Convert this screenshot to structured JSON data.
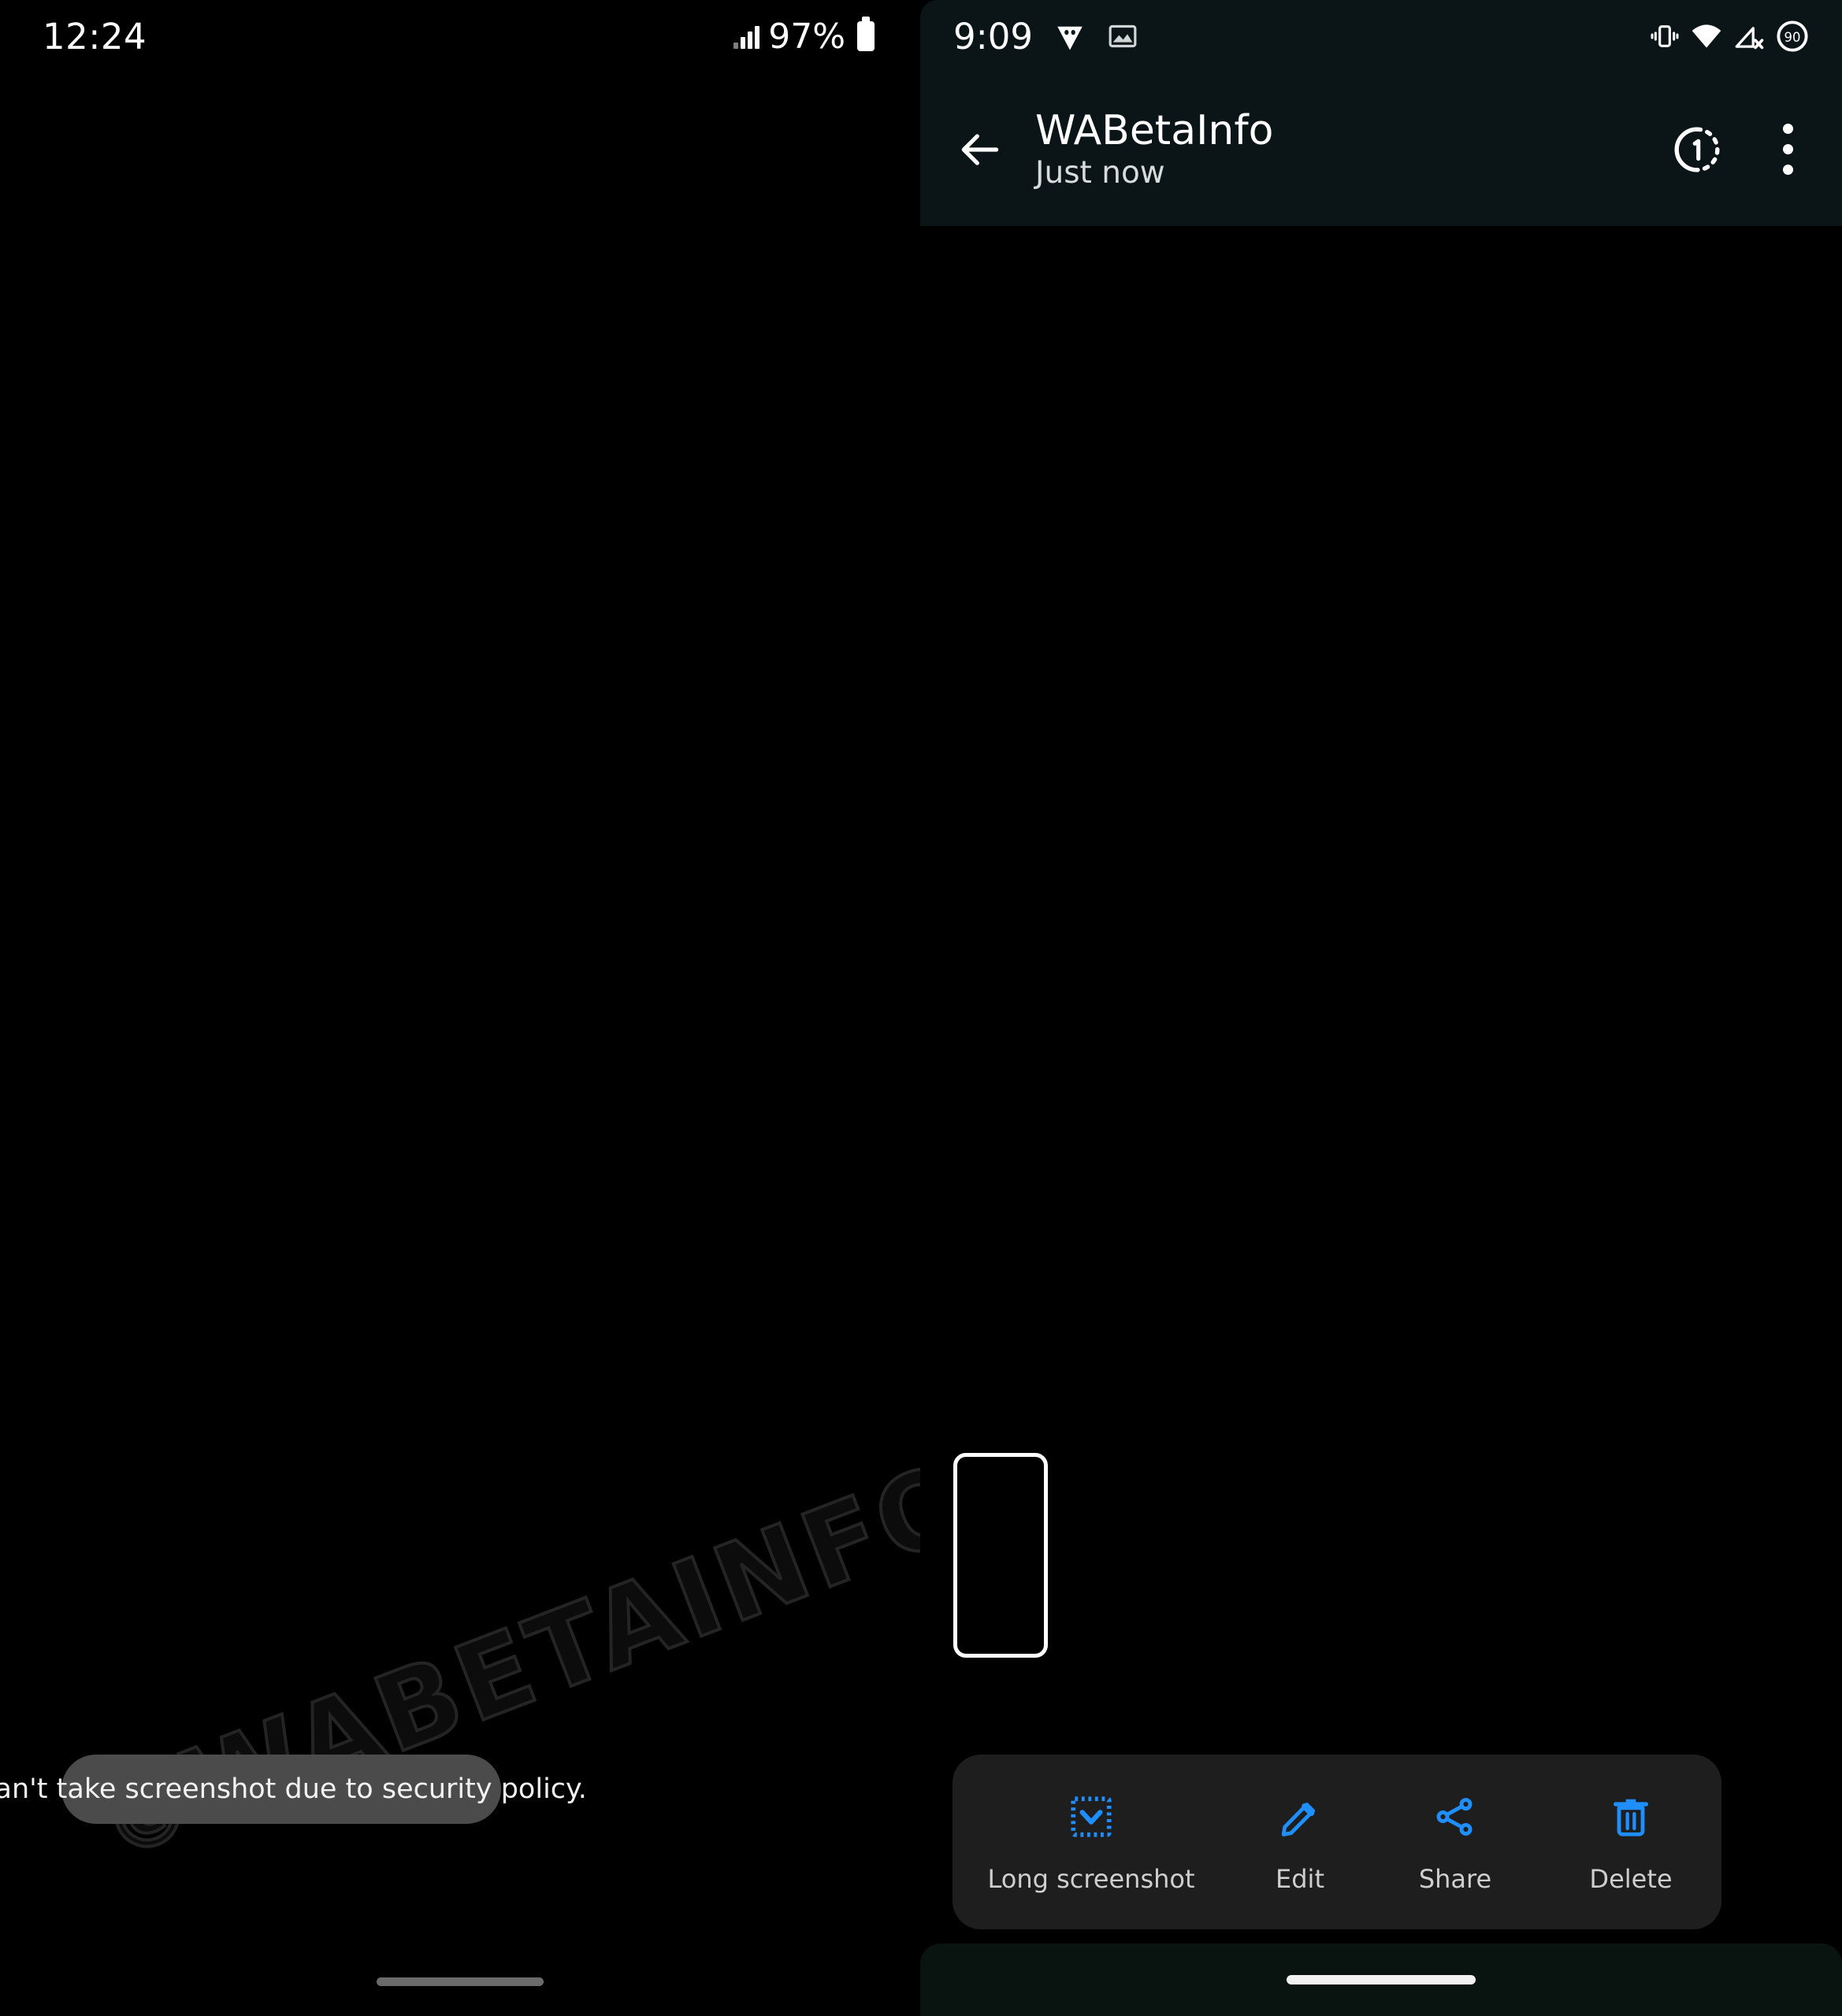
{
  "left_device": {
    "status_bar": {
      "clock": "12:24",
      "battery_percent": "97%",
      "signal_icon": "cellular-signal-icon",
      "battery_icon": "battery-full-icon"
    },
    "toast": {
      "message": "Can't take screenshot due to security policy."
    },
    "watermark": {
      "copyright_mark": "©",
      "text": "WABETAINFO"
    },
    "gesture_bar": "home-gesture-pill"
  },
  "right_device": {
    "status_bar": {
      "clock": "9:09",
      "notification_icons": [
        "whatsapp-icon",
        "screenshot-image-icon"
      ],
      "system_icons": [
        "vibrate-icon",
        "wifi-icon",
        "mobile-data-off-icon",
        "battery-circle-icon"
      ],
      "battery_level": "90"
    },
    "app_bar": {
      "back_icon": "back-arrow-icon",
      "title": "WABetaInfo",
      "subtitle": "Just now",
      "view_once_icon": "view-once-icon",
      "view_once_badge": "1",
      "overflow_icon": "overflow-menu-icon"
    },
    "screenshot_preview": {
      "label": "screenshot-thumbnail"
    },
    "action_bar": {
      "accent_color": "#1f8fff",
      "actions": [
        {
          "label": "Long screenshot",
          "icon": "long-screenshot-icon"
        },
        {
          "label": "Edit",
          "icon": "edit-pencil-icon"
        },
        {
          "label": "Share",
          "icon": "share-nodes-icon"
        },
        {
          "label": "Delete",
          "icon": "trash-icon"
        }
      ]
    },
    "gesture_bar": "home-gesture-pill"
  }
}
